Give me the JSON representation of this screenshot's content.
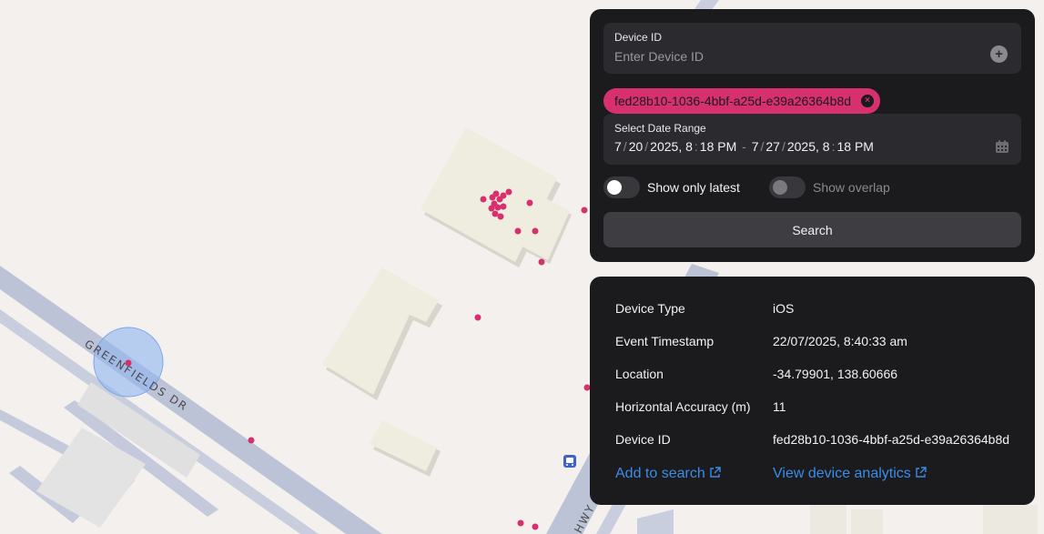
{
  "map": {
    "street_label": "GREENFIELDS DR",
    "street_label_2": "HWY",
    "point_color": "#d6306f",
    "accuracy_circle_color": "#8fb6f0"
  },
  "search_panel": {
    "device_id_label": "Device ID",
    "device_id_placeholder": "Enter Device ID",
    "device_id_value": "",
    "add_icon": "plus-circle-icon",
    "selected_device_chip": "fed28b10-1036-4bbf-a25d-e39a26364b8d",
    "date_range_label": "Select Date Range",
    "date_start": {
      "month": "7",
      "day": "20",
      "year": "2025",
      "hour": "8",
      "minute": "18",
      "ampm": "PM"
    },
    "date_end": {
      "month": "7",
      "day": "27",
      "year": "2025",
      "hour": "8",
      "minute": "18",
      "ampm": "PM"
    },
    "calendar_icon": "calendar-icon",
    "toggles": [
      {
        "label": "Show only latest",
        "enabled": true,
        "on": false
      },
      {
        "label": "Show overlap",
        "enabled": false,
        "on": false
      }
    ],
    "search_button": "Search"
  },
  "detail_panel": {
    "rows": [
      {
        "key": "Device Type",
        "value": "iOS"
      },
      {
        "key": "Event Timestamp",
        "value": "22/07/2025, 8:40:33 am"
      },
      {
        "key": "Location",
        "value": "-34.79901, 138.60666"
      },
      {
        "key": "Horizontal Accuracy (m)",
        "value": "11"
      },
      {
        "key": "Device ID",
        "value": "fed28b10-1036-4bbf-a25d-e39a26364b8d"
      }
    ],
    "add_to_search_link": "Add to search",
    "view_analytics_link": "View device analytics",
    "link_color": "#3b8ce8"
  }
}
